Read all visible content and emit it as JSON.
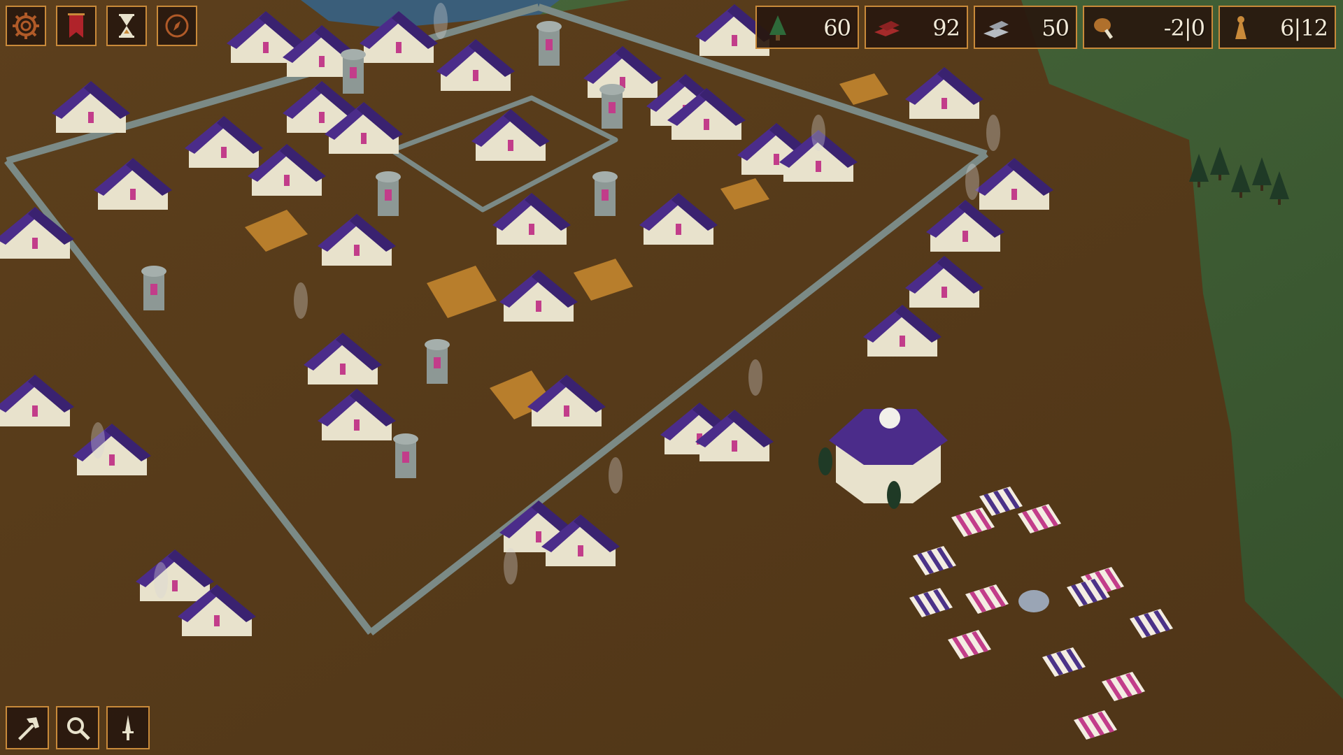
{
  "top_menu": {
    "buttons": [
      {
        "icon": "gear-icon"
      },
      {
        "icon": "banner-icon"
      },
      {
        "icon": "hourglass-icon"
      },
      {
        "icon": "compass-icon"
      }
    ]
  },
  "resources": {
    "wood": {
      "icon": "tree-icon",
      "value": "60"
    },
    "brick": {
      "icon": "bricks-icon",
      "value": "92"
    },
    "stone": {
      "icon": "stone-ingots-icon",
      "value": "50"
    },
    "food": {
      "icon": "drumstick-icon",
      "value": "-2|0"
    },
    "population": {
      "icon": "villager-icon",
      "value": "6|12"
    }
  },
  "bottom_tools": {
    "buttons": [
      {
        "icon": "hammer-icon"
      },
      {
        "icon": "magnifier-icon"
      },
      {
        "icon": "dagger-icon"
      }
    ]
  },
  "colors": {
    "ground": "#5a3e1d",
    "grass": "#3d5a33",
    "water": "#3a5e7a",
    "wall": "#7b8a86",
    "roof_purple": "#4b2c8a",
    "roof_plum": "#6b2b6a",
    "hud_border": "#c98a3a",
    "hud_bg": "#28180e"
  }
}
